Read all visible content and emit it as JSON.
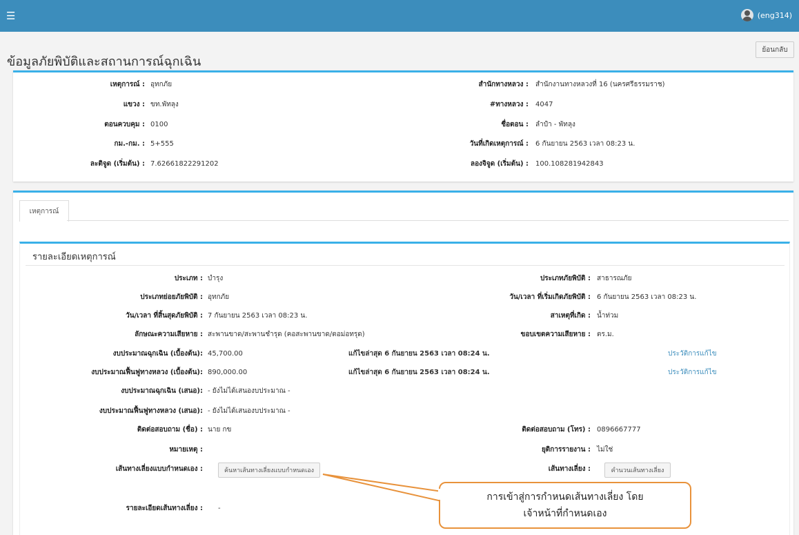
{
  "topbar": {
    "menu_icon": "hamburger-icon",
    "user": "(eng314)"
  },
  "page_title": "ข้อมูลภัยพิบัติและสถานการณ์ฉุกเฉิน",
  "back_button": "ย้อนกลับ",
  "info": {
    "left": [
      {
        "label": "เหตุการณ์ :",
        "value": "อุทกภัย"
      },
      {
        "label": "แขวง :",
        "value": "ขท.พัทลุง"
      },
      {
        "label": "ตอนควบคุม :",
        "value": "0100"
      },
      {
        "label": "กม.-กม. :",
        "value": "5+555"
      },
      {
        "label": "ละติจูด (เริ่มต้น) :",
        "value": "7.62661822291202"
      }
    ],
    "right": [
      {
        "label": "สำนักทางหลวง :",
        "value": "สำนักงานทางหลวงที่ 16 (นครศรีธรรมราช)"
      },
      {
        "label": "#ทางหลวง :",
        "value": "4047"
      },
      {
        "label": "ชื่อตอน :",
        "value": "ลำปำ - พัทลุง"
      },
      {
        "label": "วันที่เกิดเหตุการณ์ :",
        "value": "6 กันยายน 2563 เวลา 08:23 น."
      },
      {
        "label": "ลองจิจูด (เริ่มต้น) :",
        "value": "100.108281942843"
      }
    ]
  },
  "tab": "เหตุการณ์",
  "section_title": "รายละเอียดเหตุการณ์",
  "details": {
    "type_label": "ประเภท :",
    "type_value": "บำรุง",
    "disaster_type_label": "ประเภทภัยพิบัติ :",
    "disaster_type_value": "สาธารณภัย",
    "sub_type_label": "ประเภทย่อยภัยพิบัติ :",
    "sub_type_value": "อุทกภัย",
    "start_label": "วัน/เวลา ที่เริ่มเกิดภัยพิบัติ :",
    "start_value": "6 กันยายน 2563 เวลา 08:23 น.",
    "end_label": "วัน/เวลา ที่สิ้นสุดภัยพิบัติ :",
    "end_value": "7 กันยายน 2563 เวลา 08:23 น.",
    "cause_label": "สาเหตุที่เกิด :",
    "cause_value": "น้ำท่วม",
    "damage_label": "ลักษณะความเสียหาย :",
    "damage_value": "สะพานขาด/สะพานชำรุด (คอสะพานขาด/ตอม่อทรุด)",
    "scope_label": "ขอบเขตความเสียหาย :",
    "scope_value": "ตร.ม.",
    "emergency_budget_label": "งบประมาณฉุกเฉิน (เบื้องต้น):",
    "emergency_budget_value": "45,700.00",
    "emergency_edit": "แก้ไขล่าสุด 6 กันยายน 2563 เวลา 08:24 น.",
    "history_link_1": "ประวัติการแก้ไข",
    "restore_budget_label": "งบประมาณฟื้นฟูทางหลวง (เบื้องต้น):",
    "restore_budget_value": "890,000.00",
    "restore_edit": "แก้ไขล่าสุด 6 กันยายน 2563 เวลา 08:24 น.",
    "history_link_2": "ประวัติการแก้ไข",
    "emergency_prop_label": "งบประมาณฉุกเฉิน (เสนอ):",
    "emergency_prop_value": "- ยังไม่ได้เสนองบประมาณ -",
    "restore_prop_label": "งบประมาณฟื้นฟูทางหลวง (เสนอ):",
    "restore_prop_value": "- ยังไม่ได้เสนองบประมาณ -",
    "contact_name_label": "ติดต่อสอบถาม (ชื่อ) :",
    "contact_name_value": "นาย กข",
    "contact_phone_label": "ติดต่อสอบถาม (โทร) :",
    "contact_phone_value": "0896667777",
    "note_label": "หมายเหตุ :",
    "note_value": "",
    "stop_report_label": "ยุติการรายงาน :",
    "stop_report_value": "ไม่ใช่",
    "manual_detour_label": "เส้นทางเลี่ยงแบบกำหนดเอง :",
    "manual_detour_button": "ค้นหาเส้นทางเลี่ยงแบบกำหนดเอง",
    "detour_label": "เส้นทางเลี่ยง :",
    "detour_button": "คำนวนเส้นทางเลี่ยง",
    "detour_detail_label": "รายละเอียดเส้นทางเลี่ยง :",
    "detour_detail_value": "-"
  },
  "callout": {
    "line1": "การเข้าสู่การกำหนดเส้นทางเลี่ยง โดย",
    "line2": "เจ้าหน้าที่กำหนดเอง",
    "color": "#e8923b"
  }
}
